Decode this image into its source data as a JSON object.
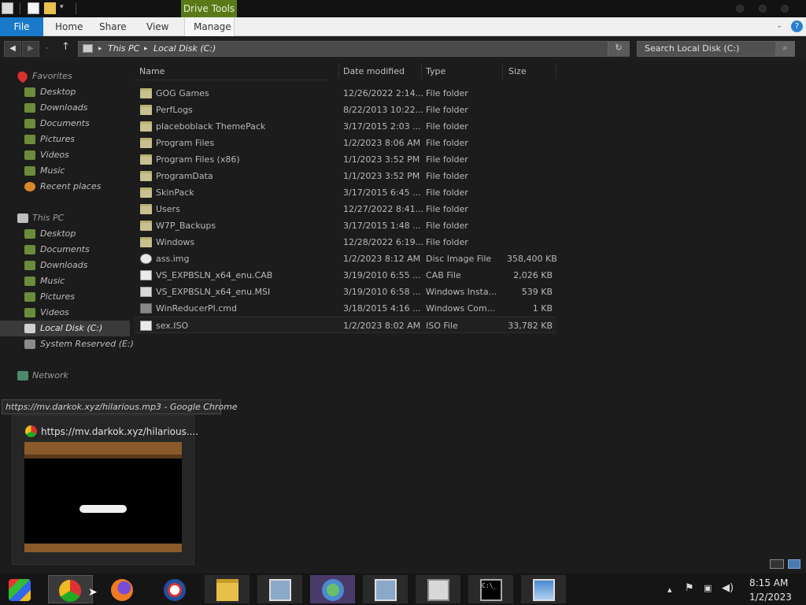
{
  "ribbon": {
    "contextual_tab": "Drive Tools",
    "tabs": [
      "File",
      "Home",
      "Share",
      "View",
      "Manage"
    ]
  },
  "address": {
    "path": [
      "This PC",
      "Local Disk (C:)"
    ],
    "search_placeholder": "Search Local Disk (C:)"
  },
  "nav_pane": {
    "favorites_label": "Favorites",
    "favorites": [
      "Desktop",
      "Downloads",
      "Documents",
      "Pictures",
      "Videos",
      "Music",
      "Recent places"
    ],
    "thispc_label": "This PC",
    "thispc": [
      "Desktop",
      "Documents",
      "Downloads",
      "Music",
      "Pictures",
      "Videos",
      "Local Disk (C:)",
      "System Reserved (E:)"
    ],
    "network_label": "Network"
  },
  "columns": {
    "name": "Name",
    "date": "Date modified",
    "type": "Type",
    "size": "Size"
  },
  "files": [
    {
      "name": "GOG Games",
      "date": "12/26/2022 2:14...",
      "type": "File folder",
      "size": "",
      "kind": "folder"
    },
    {
      "name": "PerfLogs",
      "date": "8/22/2013 10:22...",
      "type": "File folder",
      "size": "",
      "kind": "folder"
    },
    {
      "name": "placeboblack ThemePack",
      "date": "3/17/2015 2:03 ...",
      "type": "File folder",
      "size": "",
      "kind": "folder"
    },
    {
      "name": "Program Files",
      "date": "1/2/2023 8:06 AM",
      "type": "File folder",
      "size": "",
      "kind": "folder"
    },
    {
      "name": "Program Files (x86)",
      "date": "1/1/2023 3:52 PM",
      "type": "File folder",
      "size": "",
      "kind": "folder"
    },
    {
      "name": "ProgramData",
      "date": "1/1/2023 3:52 PM",
      "type": "File folder",
      "size": "",
      "kind": "folder"
    },
    {
      "name": "SkinPack",
      "date": "3/17/2015 6:45 ...",
      "type": "File folder",
      "size": "",
      "kind": "folder"
    },
    {
      "name": "Users",
      "date": "12/27/2022 8:41...",
      "type": "File folder",
      "size": "",
      "kind": "folder"
    },
    {
      "name": "W7P_Backups",
      "date": "3/17/2015 1:48 ...",
      "type": "File folder",
      "size": "",
      "kind": "folder"
    },
    {
      "name": "Windows",
      "date": "12/28/2022 6:19...",
      "type": "File folder",
      "size": "",
      "kind": "folder"
    },
    {
      "name": "ass.img",
      "date": "1/2/2023 8:12 AM",
      "type": "Disc Image File",
      "size": "358,400 KB",
      "kind": "file"
    },
    {
      "name": "VS_EXPBSLN_x64_enu.CAB",
      "date": "3/19/2010 6:55 ...",
      "type": "CAB File",
      "size": "2,026 KB",
      "kind": "file"
    },
    {
      "name": "VS_EXPBSLN_x64_enu.MSI",
      "date": "3/19/2010 6:58 ...",
      "type": "Windows Insta...",
      "size": "539 KB",
      "kind": "file"
    },
    {
      "name": "WinReducerPI.cmd",
      "date": "3/18/2015 4:16 ...",
      "type": "Windows Com...",
      "size": "1 KB",
      "kind": "file"
    },
    {
      "name": "sex.ISO",
      "date": "1/2/2023 8:02 AM",
      "type": "ISO File",
      "size": "33,782 KB",
      "kind": "file"
    }
  ],
  "tooltip": "https://mv.darkok.xyz/hilarious.mp3 - Google Chrome",
  "thumbnail_title": "https://mv.darkok.xyz/hilarious....",
  "taskbar": {
    "apps": [
      "start-orb",
      "chrome",
      "firefox",
      "obama-app",
      "file-explorer",
      "installer",
      "users-app",
      "installer-2",
      "archive",
      "cmd",
      "photo-viewer"
    ],
    "time": "8:15 AM",
    "date": "1/2/2023"
  }
}
